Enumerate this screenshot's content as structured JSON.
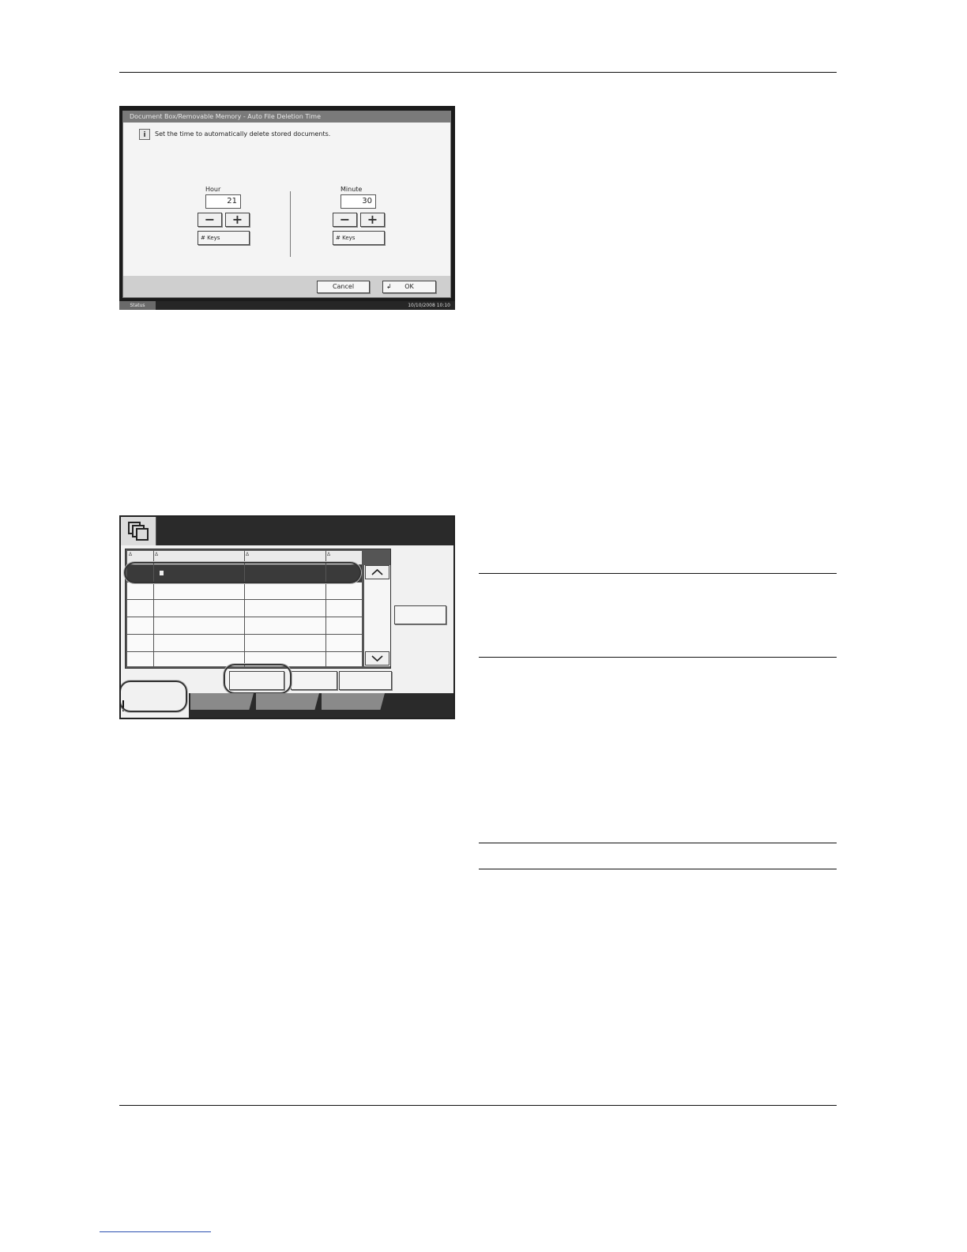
{
  "screen1": {
    "title": "Document Box/Removable Memory - Auto File Deletion Time",
    "info_icon": "info-icon",
    "message": "Set the time to automatically delete stored documents.",
    "hour": {
      "label": "Hour",
      "value": "21",
      "minus": "−",
      "plus": "+",
      "keys": "# Keys"
    },
    "minute": {
      "label": "Minute",
      "value": "30",
      "minus": "−",
      "plus": "+",
      "keys": "# Keys"
    },
    "cancel_label": "Cancel",
    "ok_label": "OK",
    "ok_icon": "↲",
    "status_label": "Status",
    "datetime": "10/10/2008   10:10"
  },
  "screen2": {
    "header_icon": "document-box-icon",
    "column_sort_marks": [
      "Δ",
      "Δ",
      "Δ",
      "Δ"
    ],
    "row_count": 6,
    "selected_row_icon": "file-icon",
    "scroll_up_icon": "chevron-up-icon",
    "scroll_down_icon": "chevron-down-icon"
  }
}
